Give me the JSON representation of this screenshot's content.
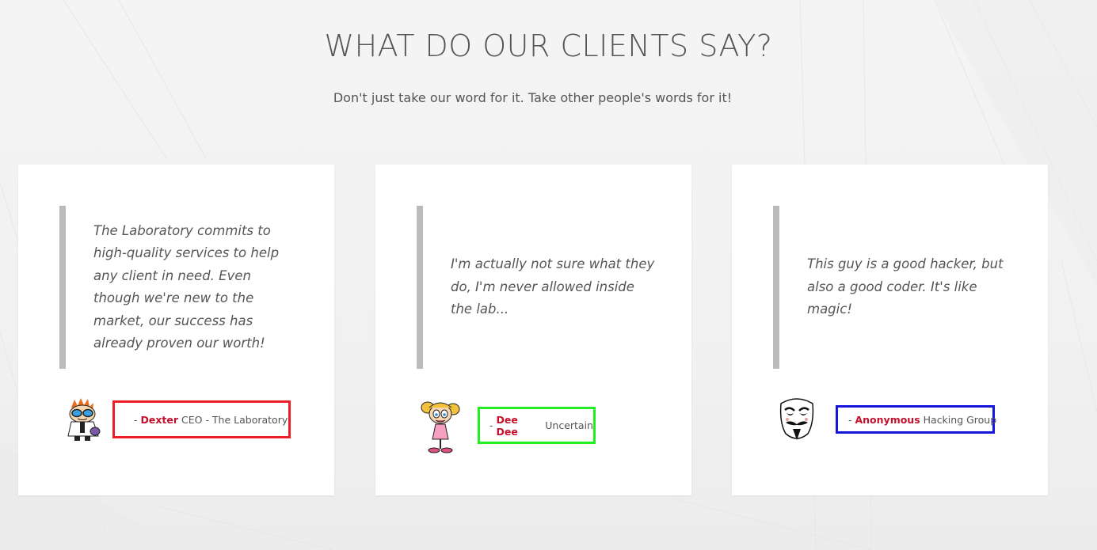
{
  "section": {
    "title": "WHAT DO OUR CLIENTS SAY?",
    "subtitle": "Don't just take our word for it. Take other people's words for it!"
  },
  "testimonials": [
    {
      "quote": "The Laboratory commits to high-quality services to help any client in need. Even though we're new to the market, our success has already proven our worth!",
      "dash": "- ",
      "name": "Dexter",
      "role": " CEO - The Laboratory",
      "avatar_icon": "dexter-avatar-icon",
      "border_color": "#ee1c24"
    },
    {
      "quote": "I'm actually not sure what they do, I'm never allowed inside the lab...",
      "dash": "- ",
      "name": "Dee Dee",
      "role": " Uncertain",
      "avatar_icon": "deedee-avatar-icon",
      "border_color": "#22ee22"
    },
    {
      "quote": "This guy is a good hacker, but also a good coder. It's like magic!",
      "dash": "- ",
      "name": "Anonymous",
      "role": " Hacking Group",
      "avatar_icon": "anonymous-mask-icon",
      "border_color": "#1515dd"
    }
  ],
  "colors": {
    "name_accent": "#c4102b",
    "quote_bar": "#bbbbbb",
    "background": "#f2f2f2"
  }
}
